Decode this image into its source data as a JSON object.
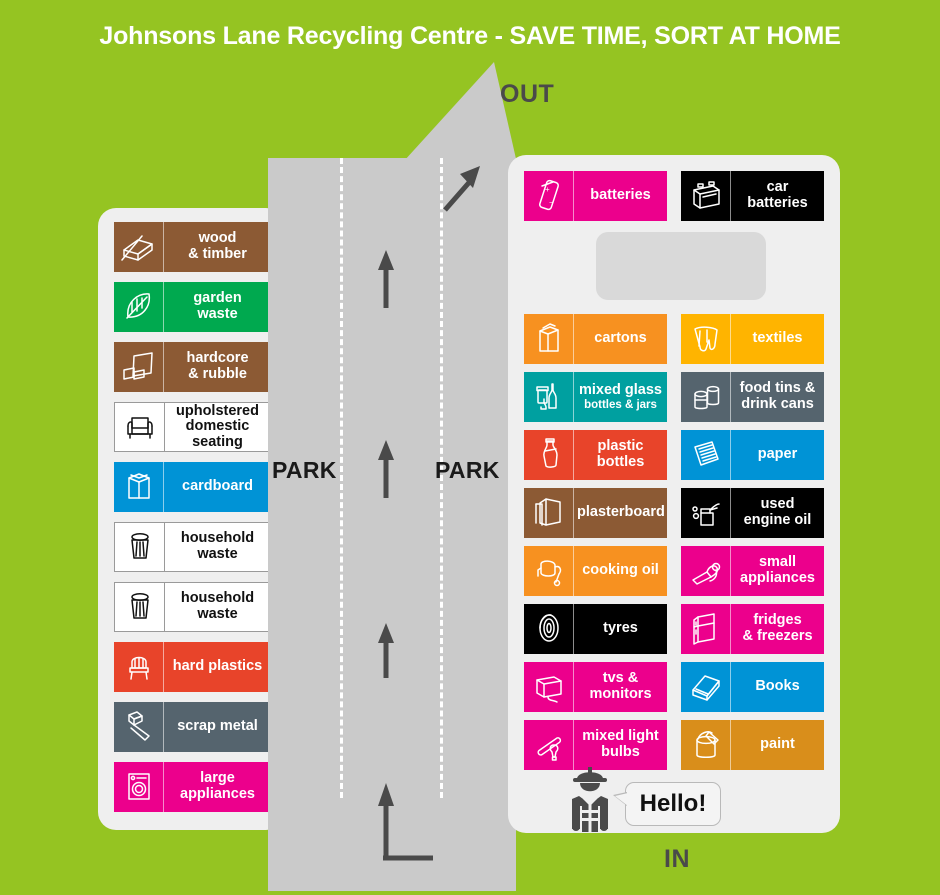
{
  "title": "Johnsons Lane Recycling Centre - SAVE TIME, SORT AT HOME",
  "road": {
    "out_label": "OUT",
    "in_label": "IN",
    "park_left_label": "PARK",
    "park_right_label": "PARK"
  },
  "worker": {
    "greeting": "Hello!",
    "icon": "worker-hard-hat-icon"
  },
  "colors": {
    "background_green": "#95c422",
    "road_grey": "#cacaca",
    "panel_grey": "#efefef",
    "blank_box_grey": "#d9d9d9",
    "title_text": "#ffffff"
  },
  "left_panel": {
    "items": [
      {
        "label": "wood",
        "label2": "& timber",
        "bg": "#8c5a34",
        "text": "#ffffff",
        "icon": "wood-timber-icon",
        "outlined": false
      },
      {
        "label": "garden",
        "label2": "waste",
        "bg": "#00a94f",
        "text": "#ffffff",
        "icon": "leaf-icon",
        "outlined": false
      },
      {
        "label": "hardcore",
        "label2": "& rubble",
        "bg": "#8c5a34",
        "text": "#ffffff",
        "icon": "hardcore-rubble-icon",
        "outlined": false
      },
      {
        "label": "upholstered",
        "label2": "domestic seating",
        "bg": "#ffffff",
        "text": "#111111",
        "icon": "armchair-icon",
        "outlined": true
      },
      {
        "label": "cardboard",
        "label2": "",
        "bg": "#0093d6",
        "text": "#ffffff",
        "icon": "cardboard-box-icon",
        "outlined": false
      },
      {
        "label": "household",
        "label2": "waste",
        "bg": "#ffffff",
        "text": "#111111",
        "icon": "wheelie-bin-icon",
        "outlined": true
      },
      {
        "label": "household",
        "label2": "waste",
        "bg": "#ffffff",
        "text": "#111111",
        "icon": "wheelie-bin-icon",
        "outlined": true
      },
      {
        "label": "hard plastics",
        "label2": "",
        "bg": "#e8442a",
        "text": "#ffffff",
        "icon": "plastic-chair-icon",
        "outlined": false
      },
      {
        "label": "scrap metal",
        "label2": "",
        "bg": "#55646e",
        "text": "#ffffff",
        "icon": "bolt-icon",
        "outlined": false
      },
      {
        "label": "large",
        "label2": "appliances",
        "bg": "#ec008c",
        "text": "#ffffff",
        "icon": "washing-machine-icon",
        "outlined": false
      }
    ]
  },
  "right_panel": {
    "top_row": [
      {
        "label": "batteries",
        "label2": "",
        "bg": "#ec008c",
        "text": "#ffffff",
        "icon": "battery-icon",
        "outlined": false
      },
      {
        "label": "car",
        "label2": "batteries",
        "bg": "#000000",
        "text": "#ffffff",
        "icon": "car-battery-icon",
        "outlined": false
      }
    ],
    "column_left": [
      {
        "label": "cartons",
        "label2": "",
        "bg": "#f79120",
        "text": "#ffffff",
        "icon": "carton-icon",
        "outlined": false
      },
      {
        "label": "mixed glass",
        "label2": "bottles & jars",
        "bg": "#00a0a0",
        "text": "#ffffff",
        "icon": "glass-bottles-icon",
        "outlined": false
      },
      {
        "label": "plastic bottles",
        "label2": "",
        "bg": "#e8442a",
        "text": "#ffffff",
        "icon": "plastic-bottle-icon",
        "outlined": false
      },
      {
        "label": "plasterboard",
        "label2": "",
        "bg": "#8c5a34",
        "text": "#ffffff",
        "icon": "plasterboard-icon",
        "outlined": false
      },
      {
        "label": "cooking oil",
        "label2": "",
        "bg": "#f79120",
        "text": "#ffffff",
        "icon": "cooking-oil-icon",
        "outlined": false
      },
      {
        "label": "tyres",
        "label2": "",
        "bg": "#000000",
        "text": "#ffffff",
        "icon": "tyre-icon",
        "outlined": false
      },
      {
        "label": "tvs &",
        "label2": "monitors",
        "bg": "#ec008c",
        "text": "#ffffff",
        "icon": "monitor-icon",
        "outlined": false
      },
      {
        "label": "mixed light",
        "label2": "bulbs",
        "bg": "#ec008c",
        "text": "#ffffff",
        "icon": "light-bulbs-icon",
        "outlined": false
      }
    ],
    "column_right": [
      {
        "label": "textiles",
        "label2": "",
        "bg": "#ffb400",
        "text": "#ffffff",
        "icon": "textiles-icon",
        "outlined": false
      },
      {
        "label": "food tins &",
        "label2": "drink cans",
        "bg": "#55646e",
        "text": "#ffffff",
        "icon": "tin-cans-icon",
        "outlined": false
      },
      {
        "label": "paper",
        "label2": "",
        "bg": "#0093d6",
        "text": "#ffffff",
        "icon": "paper-icon",
        "outlined": false
      },
      {
        "label": "used",
        "label2": "engine oil",
        "bg": "#000000",
        "text": "#ffffff",
        "icon": "engine-oil-can-icon",
        "outlined": false
      },
      {
        "label": "small",
        "label2": "appliances",
        "bg": "#ec008c",
        "text": "#ffffff",
        "icon": "small-appliances-icon",
        "outlined": false
      },
      {
        "label": "fridges",
        "label2": "& freezers",
        "bg": "#ec008c",
        "text": "#ffffff",
        "icon": "fridge-icon",
        "outlined": false
      },
      {
        "label": "Books",
        "label2": "",
        "bg": "#0093d6",
        "text": "#ffffff",
        "icon": "books-icon",
        "outlined": false
      },
      {
        "label": "paint",
        "label2": "",
        "bg": "#d98e1b",
        "text": "#ffffff",
        "icon": "paint-can-icon",
        "outlined": false
      }
    ]
  }
}
